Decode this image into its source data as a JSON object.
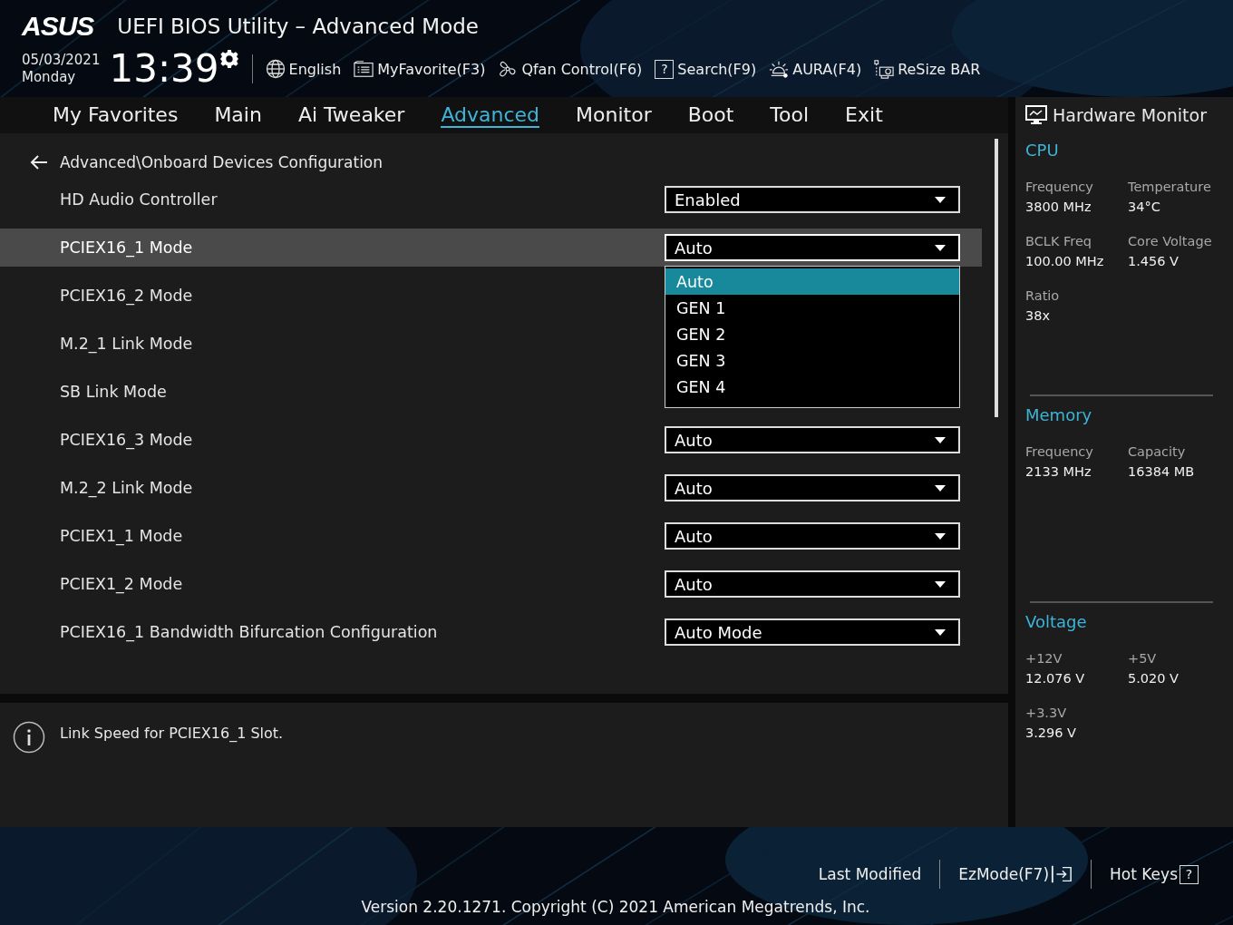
{
  "header": {
    "logo": "ASUS",
    "title": "UEFI BIOS Utility – Advanced Mode",
    "date": "05/03/2021",
    "day": "Monday",
    "time": "13:39",
    "tools": [
      {
        "kind": "globe",
        "label": "English"
      },
      {
        "kind": "favorite",
        "label": "MyFavorite(F3)"
      },
      {
        "kind": "fan",
        "label": "Qfan Control(F6)"
      },
      {
        "kind": "search",
        "key": "?",
        "label": "Search(F9)"
      },
      {
        "kind": "aura",
        "label": "AURA(F4)"
      },
      {
        "kind": "card",
        "label": "ReSize BAR"
      }
    ]
  },
  "tabs": [
    {
      "label": "My Favorites",
      "selected": false
    },
    {
      "label": "Main",
      "selected": false
    },
    {
      "label": "Ai Tweaker",
      "selected": false
    },
    {
      "label": "Advanced",
      "selected": true
    },
    {
      "label": "Monitor",
      "selected": false
    },
    {
      "label": "Boot",
      "selected": false
    },
    {
      "label": "Tool",
      "selected": false
    },
    {
      "label": "Exit",
      "selected": false
    }
  ],
  "breadcrumb": "Advanced\\Onboard Devices Configuration",
  "settings": [
    {
      "label": "HD Audio Controller",
      "value": "Enabled",
      "selected": false,
      "expanded": false
    },
    {
      "label": "PCIEX16_1 Mode",
      "value": "Auto",
      "selected": true,
      "expanded": true,
      "options": [
        {
          "label": "Auto",
          "selected": true
        },
        {
          "label": "GEN 1",
          "selected": false
        },
        {
          "label": "GEN 2",
          "selected": false
        },
        {
          "label": "GEN 3",
          "selected": false
        },
        {
          "label": "GEN 4",
          "selected": false
        }
      ]
    },
    {
      "label": "PCIEX16_2 Mode",
      "selected": false
    },
    {
      "label": "M.2_1 Link Mode",
      "selected": false
    },
    {
      "label": "SB Link Mode",
      "selected": false
    },
    {
      "label": "PCIEX16_3 Mode",
      "value": "Auto",
      "selected": false,
      "expanded": false
    },
    {
      "label": "M.2_2 Link Mode",
      "value": "Auto",
      "selected": false,
      "expanded": false
    },
    {
      "label": "PCIEX1_1 Mode",
      "value": "Auto",
      "selected": false,
      "expanded": false
    },
    {
      "label": "PCIEX1_2 Mode",
      "value": "Auto",
      "selected": false,
      "expanded": false
    },
    {
      "label": "PCIEX16_1 Bandwidth Bifurcation Configuration",
      "value": "Auto Mode",
      "selected": false,
      "expanded": false
    }
  ],
  "help": "Link Speed for PCIEX16_1 Slot.",
  "hardware_monitor": {
    "title": "Hardware Monitor",
    "sections": [
      {
        "title": "CPU",
        "items": [
          {
            "label": "Frequency",
            "value": "3800 MHz"
          },
          {
            "label": "Temperature",
            "value": "34°C"
          },
          {
            "label": "BCLK Freq",
            "value": "100.00 MHz"
          },
          {
            "label": "Core Voltage",
            "value": "1.456 V"
          },
          {
            "label": "Ratio",
            "value": "38x"
          }
        ]
      },
      {
        "title": "Memory",
        "items": [
          {
            "label": "Frequency",
            "value": "2133 MHz"
          },
          {
            "label": "Capacity",
            "value": "16384 MB"
          }
        ]
      },
      {
        "title": "Voltage",
        "items": [
          {
            "label": "+12V",
            "value": "12.076 V"
          },
          {
            "label": "+5V",
            "value": "5.020 V"
          },
          {
            "label": "+3.3V",
            "value": "3.296 V"
          }
        ]
      }
    ]
  },
  "footer": {
    "items": [
      {
        "kind": "text",
        "label": "Last Modified"
      },
      {
        "kind": "ezmode",
        "label": "EzMode(F7)"
      },
      {
        "kind": "hotkeys",
        "label": "Hot Keys",
        "key": "?"
      }
    ],
    "version": "Version 2.20.1271. Copyright (C) 2021 American Megatrends, Inc."
  }
}
